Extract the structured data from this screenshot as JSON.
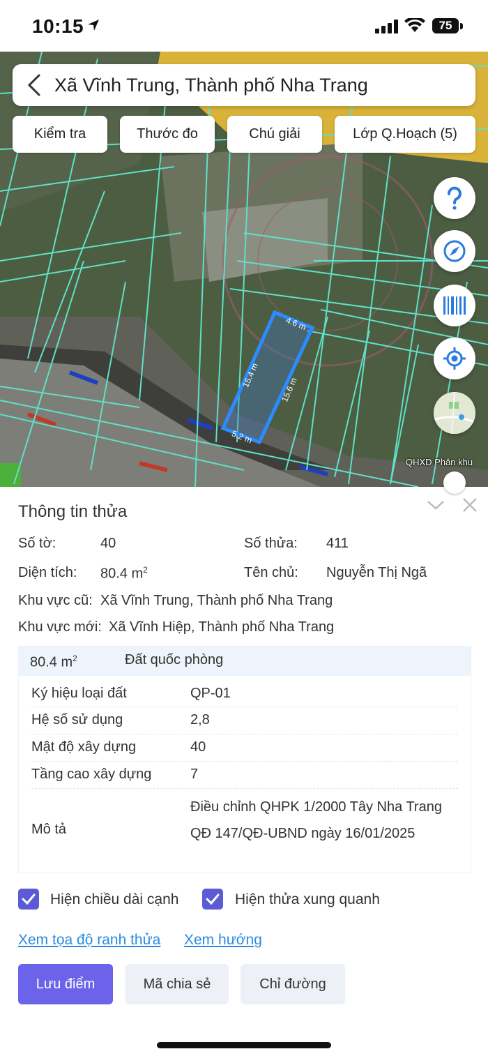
{
  "status": {
    "time": "10:15",
    "battery": "75"
  },
  "search": {
    "title": "Xã Vĩnh Trung, Thành phố Nha Trang"
  },
  "toolbar": [
    {
      "label": "Kiểm tra"
    },
    {
      "label": "Thước đo"
    },
    {
      "label": "Chú giải"
    },
    {
      "label": "Lớp Q.Hoạch (5)"
    }
  ],
  "map": {
    "edges": {
      "top": "4.6 m",
      "left": "15.4 m",
      "right": "15.6 m",
      "bottom": "5.2 m"
    },
    "layer_label": "QHXD Phân khu"
  },
  "panel": {
    "title": "Thông tin thửa",
    "so_to_label": "Số tờ:",
    "so_to": "40",
    "so_thua_label": "Số thửa:",
    "so_thua": "411",
    "dien_tich_label": "Diện tích:",
    "dien_tich": "80.4 m",
    "dien_tich_unit_sup": "2",
    "ten_chu_label": "Tên chủ:",
    "ten_chu": "Nguyễn Thị Ngã",
    "kv_cu_label": "Khu vực cũ:",
    "kv_cu": "Xã Vĩnh Trung, Thành phố Nha Trang",
    "kv_moi_label": "Khu vực mới:",
    "kv_moi": "Xã Vĩnh Hiệp, Thành phố Nha Trang"
  },
  "detail": {
    "area": "80.4 m",
    "area_sup": "2",
    "land_type": "Đất quốc phòng",
    "rows": [
      {
        "k": "Ký hiệu loại đất",
        "v": "QP-01"
      },
      {
        "k": "Hệ số sử dụng",
        "v": "2,8"
      },
      {
        "k": "Mật độ xây dựng",
        "v": "40"
      },
      {
        "k": "Tầng cao xây dựng",
        "v": "7"
      }
    ],
    "mo_ta_label": "Mô tả",
    "mo_ta": "Điều chỉnh QHPK 1/2000 Tây Nha Trang QĐ 147/QĐ-UBND ngày 16/01/2025"
  },
  "options": {
    "show_edges": "Hiện chiều dài cạnh",
    "show_neighbors": "Hiện thửa xung quanh"
  },
  "links": {
    "coords": "Xem tọa độ ranh thửa",
    "direction": "Xem hướng"
  },
  "actions": {
    "save": "Lưu điểm",
    "share": "Mã chia sẻ",
    "route": "Chỉ đường"
  },
  "colors": {
    "accent": "#6b63ea",
    "link": "#2a8be0",
    "parcel_outline": "#2b8cff",
    "grid_line": "#5fe0c8"
  }
}
